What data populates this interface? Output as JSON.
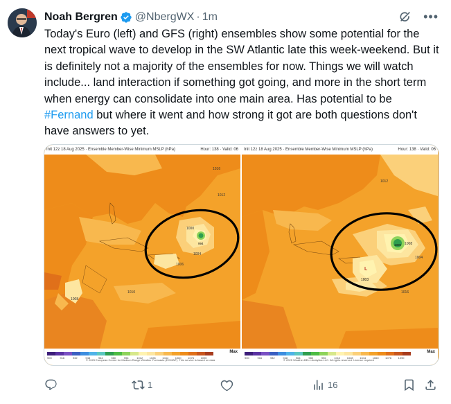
{
  "author": {
    "name": "Noah Bergren",
    "handle": "@NbergWX",
    "separator": "·",
    "time": "1m"
  },
  "tweet": {
    "text_before_hashtag": "Today's Euro (left) and GFS (right) ensembles show some potential for the next tropical wave to develop in the SW Atlantic late this week-weekend. But it is definitely not a majority of the ensembles for now. Things we will watch include... land interaction if something got going, and more in the short term when energy can consolidate into one main area. Has potential to be ",
    "hashtag": "#Fernand",
    "text_after_hashtag": " but where it went and how strong it got are both questions don't have answers to yet."
  },
  "media": {
    "left_map": {
      "header_left": "Init 12z 18 Aug 2025 · Ensemble Member-Wise Minimum MSLP (hPa)",
      "header_right": "Hour: 138 · Valid: 06",
      "max_label": "Max",
      "credit": "© 2025 European Centre for Medium Range Weather Forecasts (ECMWF). This service is based on data",
      "labels": [
        "1016",
        "1012",
        "1008",
        "1010",
        "1006",
        "1000",
        "1004",
        "994"
      ]
    },
    "right_map": {
      "header_left": "Init 12z 18 Aug 2025 · Ensemble Member-Wise Minimum MSLP (hPa)",
      "header_right": "Hour: 138 · Valid: 06",
      "max_label": "Max",
      "credit": "© 2025 Weather.BELL Analytics LLC. All rights reserved. License required",
      "labels": [
        "1012",
        "1008",
        "1004",
        "1016",
        "1003",
        "1000"
      ]
    },
    "colorbar_colors": [
      "#3d1f7a",
      "#5a32a3",
      "#7a50c4",
      "#3a5fc2",
      "#3d8ee0",
      "#4fb3e8",
      "#5bc7c0",
      "#2e9e4f",
      "#4cbc44",
      "#8dd35a",
      "#d7e88a",
      "#fff3b0",
      "#fde6a0",
      "#fbd07a",
      "#f8b84e",
      "#f4a22a",
      "#ee8c1a",
      "#e0701a",
      "#c8561e",
      "#a83c1e"
    ],
    "colorbar_ticks": [
      "900",
      "916",
      "932",
      "948",
      "964",
      "980",
      "996",
      "1012",
      "1028",
      "1044",
      "1060",
      "1076",
      "1090"
    ]
  },
  "actions": {
    "reply_count": "",
    "repost_count": "1",
    "like_count": "",
    "views_count": "16"
  }
}
